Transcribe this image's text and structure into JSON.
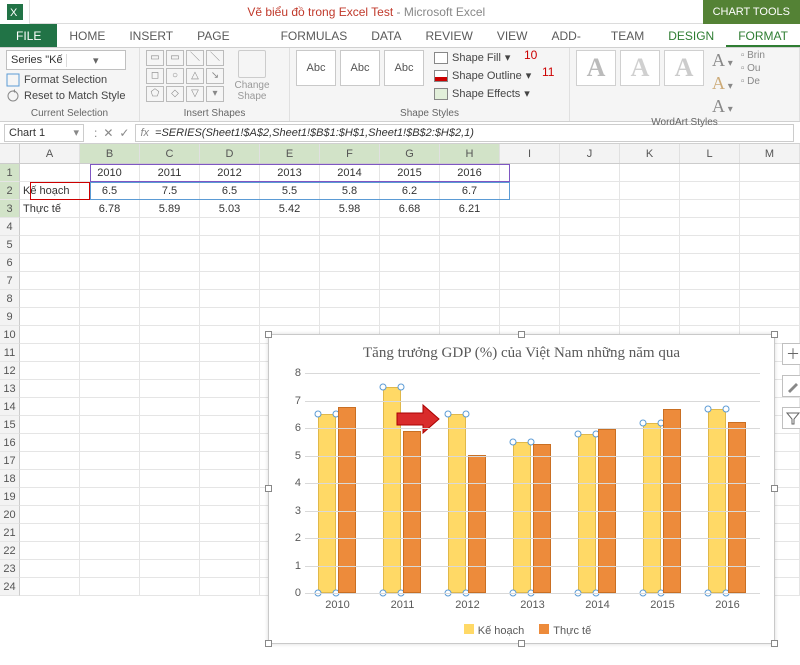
{
  "titlebar": {
    "document": "Vẽ biểu đồ trong Excel Test",
    "app": "Microsoft Excel",
    "context_title": "CHART TOOLS"
  },
  "tabs": {
    "file": "FILE",
    "home": "HOME",
    "insert": "INSERT",
    "page_layout": "PAGE LAYOUT",
    "formulas": "FORMULAS",
    "data": "DATA",
    "review": "REVIEW",
    "view": "VIEW",
    "addins": "ADD-INS",
    "team": "TEAM",
    "design": "DESIGN",
    "format": "FORMAT"
  },
  "ribbon": {
    "current_selection": {
      "selector_value": "Series \"Kế hoạch\"",
      "format_selection": "Format Selection",
      "reset": "Reset to Match Style",
      "label": "Current Selection"
    },
    "insert_shapes": {
      "change_shape": "Change\nShape",
      "label": "Insert Shapes"
    },
    "shape_styles": {
      "abc": "Abc",
      "shape_fill": "Shape Fill",
      "shape_outline": "Shape Outline",
      "shape_effects": "Shape Effects",
      "label": "Shape Styles",
      "note10": "10",
      "note11": "11"
    },
    "wordart": {
      "label": "WordArt Styles",
      "brin": "Brin",
      "ou": "Ou",
      "de": "De"
    }
  },
  "name_box": "Chart 1",
  "formula": "=SERIES(Sheet1!$A$2,Sheet1!$B$1:$H$1,Sheet1!$B$2:$H$2,1)",
  "columns": [
    "A",
    "B",
    "C",
    "D",
    "E",
    "F",
    "G",
    "H",
    "I",
    "J",
    "K",
    "L",
    "M"
  ],
  "table": {
    "rows": [
      {
        "label": "",
        "cells": [
          "",
          "2010",
          "2011",
          "2012",
          "2013",
          "2014",
          "2015",
          "2016"
        ]
      },
      {
        "label": "Kế hoạch",
        "cells": [
          "Kế hoạch",
          "6.5",
          "7.5",
          "6.5",
          "5.5",
          "5.8",
          "6.2",
          "6.7"
        ]
      },
      {
        "label": "Thực tế",
        "cells": [
          "Thực tế",
          "6.78",
          "5.89",
          "5.03",
          "5.42",
          "5.98",
          "6.68",
          "6.21"
        ]
      }
    ],
    "row_count": 24
  },
  "chart": {
    "title": "Tăng trưởng GDP (%) của Việt Nam những năm qua",
    "legend": {
      "s1": "Kế hoạch",
      "s2": "Thực tế"
    },
    "y_ticks": [
      0,
      1,
      2,
      3,
      4,
      5,
      6,
      7,
      8
    ],
    "y_max": 8
  },
  "chart_data": {
    "type": "bar",
    "title": "Tăng trưởng GDP (%) của Việt Nam những năm qua",
    "xlabel": "",
    "ylabel": "",
    "ylim": [
      0,
      8
    ],
    "categories": [
      "2010",
      "2011",
      "2012",
      "2013",
      "2014",
      "2015",
      "2016"
    ],
    "series": [
      {
        "name": "Kế hoạch",
        "color": "#ffd966",
        "values": [
          6.5,
          7.5,
          6.5,
          5.5,
          5.8,
          6.2,
          6.7
        ]
      },
      {
        "name": "Thực tế",
        "color": "#ed8b3b",
        "values": [
          6.78,
          5.89,
          5.03,
          5.42,
          5.98,
          6.68,
          6.21
        ]
      }
    ],
    "legend_position": "bottom",
    "grid": true
  }
}
